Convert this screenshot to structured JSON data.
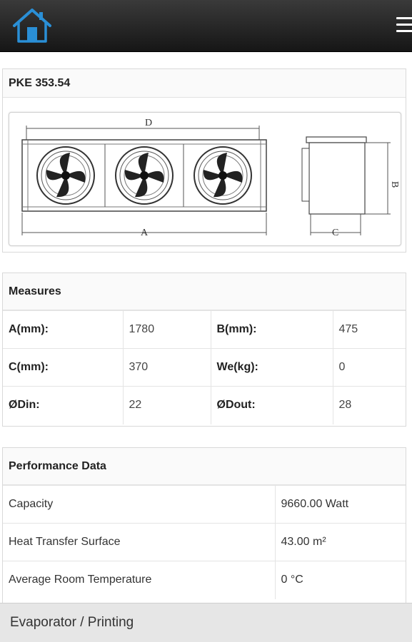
{
  "header": {
    "home_icon": "home-icon",
    "menu_icon": "hamburger-menu-icon"
  },
  "product": {
    "title": "PKE 353.54",
    "drawing_labels": {
      "d": "D",
      "a": "A",
      "b": "B",
      "c": "C"
    }
  },
  "measures": {
    "title": "Measures",
    "rows": [
      {
        "l1": "A(mm):",
        "v1": "1780",
        "l2": "B(mm):",
        "v2": "475"
      },
      {
        "l1": "C(mm):",
        "v1": "370",
        "l2": "We(kg):",
        "v2": "0"
      },
      {
        "l1": "ØDin:",
        "v1": "22",
        "l2": "ØDout:",
        "v2": "28"
      }
    ]
  },
  "performance": {
    "title": "Performance Data",
    "rows": [
      {
        "label": "Capacity",
        "value": "9660.00 Watt"
      },
      {
        "label": "Heat Transfer Surface",
        "value": "43.00 m²"
      },
      {
        "label": "Average Room Temperature",
        "value": "0 °C"
      }
    ]
  },
  "footer": {
    "label": "Evaporator / Printing"
  },
  "colors": {
    "accent": "#2a8fd6",
    "topbar": "#1e1e1e",
    "footer": "#e6e6e6"
  }
}
